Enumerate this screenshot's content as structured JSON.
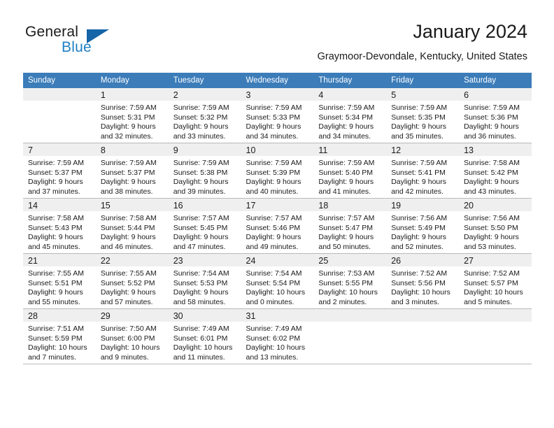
{
  "brand": {
    "word_one": "General",
    "word_two": "Blue",
    "logo_icon": "triangle-logo-icon",
    "accent_color": "#1f7fc4"
  },
  "header": {
    "month_title": "January 2024",
    "location": "Graymoor-Devondale, Kentucky, United States"
  },
  "calendar": {
    "header_bg": "#3b7cb9",
    "weekday_headers": [
      "Sunday",
      "Monday",
      "Tuesday",
      "Wednesday",
      "Thursday",
      "Friday",
      "Saturday"
    ],
    "weeks": [
      [
        {
          "day": "",
          "lines": []
        },
        {
          "day": "1",
          "lines": [
            "Sunrise: 7:59 AM",
            "Sunset: 5:31 PM",
            "Daylight: 9 hours",
            "and 32 minutes."
          ]
        },
        {
          "day": "2",
          "lines": [
            "Sunrise: 7:59 AM",
            "Sunset: 5:32 PM",
            "Daylight: 9 hours",
            "and 33 minutes."
          ]
        },
        {
          "day": "3",
          "lines": [
            "Sunrise: 7:59 AM",
            "Sunset: 5:33 PM",
            "Daylight: 9 hours",
            "and 34 minutes."
          ]
        },
        {
          "day": "4",
          "lines": [
            "Sunrise: 7:59 AM",
            "Sunset: 5:34 PM",
            "Daylight: 9 hours",
            "and 34 minutes."
          ]
        },
        {
          "day": "5",
          "lines": [
            "Sunrise: 7:59 AM",
            "Sunset: 5:35 PM",
            "Daylight: 9 hours",
            "and 35 minutes."
          ]
        },
        {
          "day": "6",
          "lines": [
            "Sunrise: 7:59 AM",
            "Sunset: 5:36 PM",
            "Daylight: 9 hours",
            "and 36 minutes."
          ]
        }
      ],
      [
        {
          "day": "7",
          "lines": [
            "Sunrise: 7:59 AM",
            "Sunset: 5:37 PM",
            "Daylight: 9 hours",
            "and 37 minutes."
          ]
        },
        {
          "day": "8",
          "lines": [
            "Sunrise: 7:59 AM",
            "Sunset: 5:37 PM",
            "Daylight: 9 hours",
            "and 38 minutes."
          ]
        },
        {
          "day": "9",
          "lines": [
            "Sunrise: 7:59 AM",
            "Sunset: 5:38 PM",
            "Daylight: 9 hours",
            "and 39 minutes."
          ]
        },
        {
          "day": "10",
          "lines": [
            "Sunrise: 7:59 AM",
            "Sunset: 5:39 PM",
            "Daylight: 9 hours",
            "and 40 minutes."
          ]
        },
        {
          "day": "11",
          "lines": [
            "Sunrise: 7:59 AM",
            "Sunset: 5:40 PM",
            "Daylight: 9 hours",
            "and 41 minutes."
          ]
        },
        {
          "day": "12",
          "lines": [
            "Sunrise: 7:59 AM",
            "Sunset: 5:41 PM",
            "Daylight: 9 hours",
            "and 42 minutes."
          ]
        },
        {
          "day": "13",
          "lines": [
            "Sunrise: 7:58 AM",
            "Sunset: 5:42 PM",
            "Daylight: 9 hours",
            "and 43 minutes."
          ]
        }
      ],
      [
        {
          "day": "14",
          "lines": [
            "Sunrise: 7:58 AM",
            "Sunset: 5:43 PM",
            "Daylight: 9 hours",
            "and 45 minutes."
          ]
        },
        {
          "day": "15",
          "lines": [
            "Sunrise: 7:58 AM",
            "Sunset: 5:44 PM",
            "Daylight: 9 hours",
            "and 46 minutes."
          ]
        },
        {
          "day": "16",
          "lines": [
            "Sunrise: 7:57 AM",
            "Sunset: 5:45 PM",
            "Daylight: 9 hours",
            "and 47 minutes."
          ]
        },
        {
          "day": "17",
          "lines": [
            "Sunrise: 7:57 AM",
            "Sunset: 5:46 PM",
            "Daylight: 9 hours",
            "and 49 minutes."
          ]
        },
        {
          "day": "18",
          "lines": [
            "Sunrise: 7:57 AM",
            "Sunset: 5:47 PM",
            "Daylight: 9 hours",
            "and 50 minutes."
          ]
        },
        {
          "day": "19",
          "lines": [
            "Sunrise: 7:56 AM",
            "Sunset: 5:49 PM",
            "Daylight: 9 hours",
            "and 52 minutes."
          ]
        },
        {
          "day": "20",
          "lines": [
            "Sunrise: 7:56 AM",
            "Sunset: 5:50 PM",
            "Daylight: 9 hours",
            "and 53 minutes."
          ]
        }
      ],
      [
        {
          "day": "21",
          "lines": [
            "Sunrise: 7:55 AM",
            "Sunset: 5:51 PM",
            "Daylight: 9 hours",
            "and 55 minutes."
          ]
        },
        {
          "day": "22",
          "lines": [
            "Sunrise: 7:55 AM",
            "Sunset: 5:52 PM",
            "Daylight: 9 hours",
            "and 57 minutes."
          ]
        },
        {
          "day": "23",
          "lines": [
            "Sunrise: 7:54 AM",
            "Sunset: 5:53 PM",
            "Daylight: 9 hours",
            "and 58 minutes."
          ]
        },
        {
          "day": "24",
          "lines": [
            "Sunrise: 7:54 AM",
            "Sunset: 5:54 PM",
            "Daylight: 10 hours",
            "and 0 minutes."
          ]
        },
        {
          "day": "25",
          "lines": [
            "Sunrise: 7:53 AM",
            "Sunset: 5:55 PM",
            "Daylight: 10 hours",
            "and 2 minutes."
          ]
        },
        {
          "day": "26",
          "lines": [
            "Sunrise: 7:52 AM",
            "Sunset: 5:56 PM",
            "Daylight: 10 hours",
            "and 3 minutes."
          ]
        },
        {
          "day": "27",
          "lines": [
            "Sunrise: 7:52 AM",
            "Sunset: 5:57 PM",
            "Daylight: 10 hours",
            "and 5 minutes."
          ]
        }
      ],
      [
        {
          "day": "28",
          "lines": [
            "Sunrise: 7:51 AM",
            "Sunset: 5:59 PM",
            "Daylight: 10 hours",
            "and 7 minutes."
          ]
        },
        {
          "day": "29",
          "lines": [
            "Sunrise: 7:50 AM",
            "Sunset: 6:00 PM",
            "Daylight: 10 hours",
            "and 9 minutes."
          ]
        },
        {
          "day": "30",
          "lines": [
            "Sunrise: 7:49 AM",
            "Sunset: 6:01 PM",
            "Daylight: 10 hours",
            "and 11 minutes."
          ]
        },
        {
          "day": "31",
          "lines": [
            "Sunrise: 7:49 AM",
            "Sunset: 6:02 PM",
            "Daylight: 10 hours",
            "and 13 minutes."
          ]
        },
        {
          "day": "",
          "lines": []
        },
        {
          "day": "",
          "lines": []
        },
        {
          "day": "",
          "lines": []
        }
      ]
    ]
  }
}
